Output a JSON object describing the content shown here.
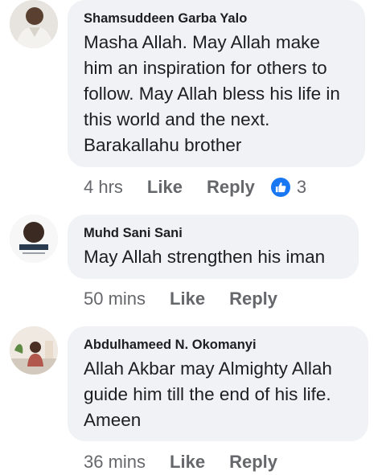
{
  "comments": [
    {
      "author": "Shamsuddeen Garba Yalo",
      "text": "Masha Allah. May Allah make him an inspiration for others to follow. May Allah bless his life in this world and the next. Barakallahu brother",
      "time": "4 hrs",
      "like_label": "Like",
      "reply_label": "Reply",
      "reaction": {
        "icon": "thumbs-up-icon",
        "count": "3"
      }
    },
    {
      "author": "Muhd Sani Sani",
      "text": "May Allah strengthen his iman",
      "time": "50 mins",
      "like_label": "Like",
      "reply_label": "Reply",
      "avatar_caption": "MUHAMMAD"
    },
    {
      "author": "Abdulhameed N. Okomanyi",
      "text": "Allah Akbar may Almighty Allah guide him till the end of his life. Ameen",
      "time": "36 mins",
      "like_label": "Like",
      "reply_label": "Reply"
    }
  ],
  "colors": {
    "bubble": "#f0f2f5",
    "meta_text": "#65676b",
    "like_accent": "#1877f2"
  }
}
